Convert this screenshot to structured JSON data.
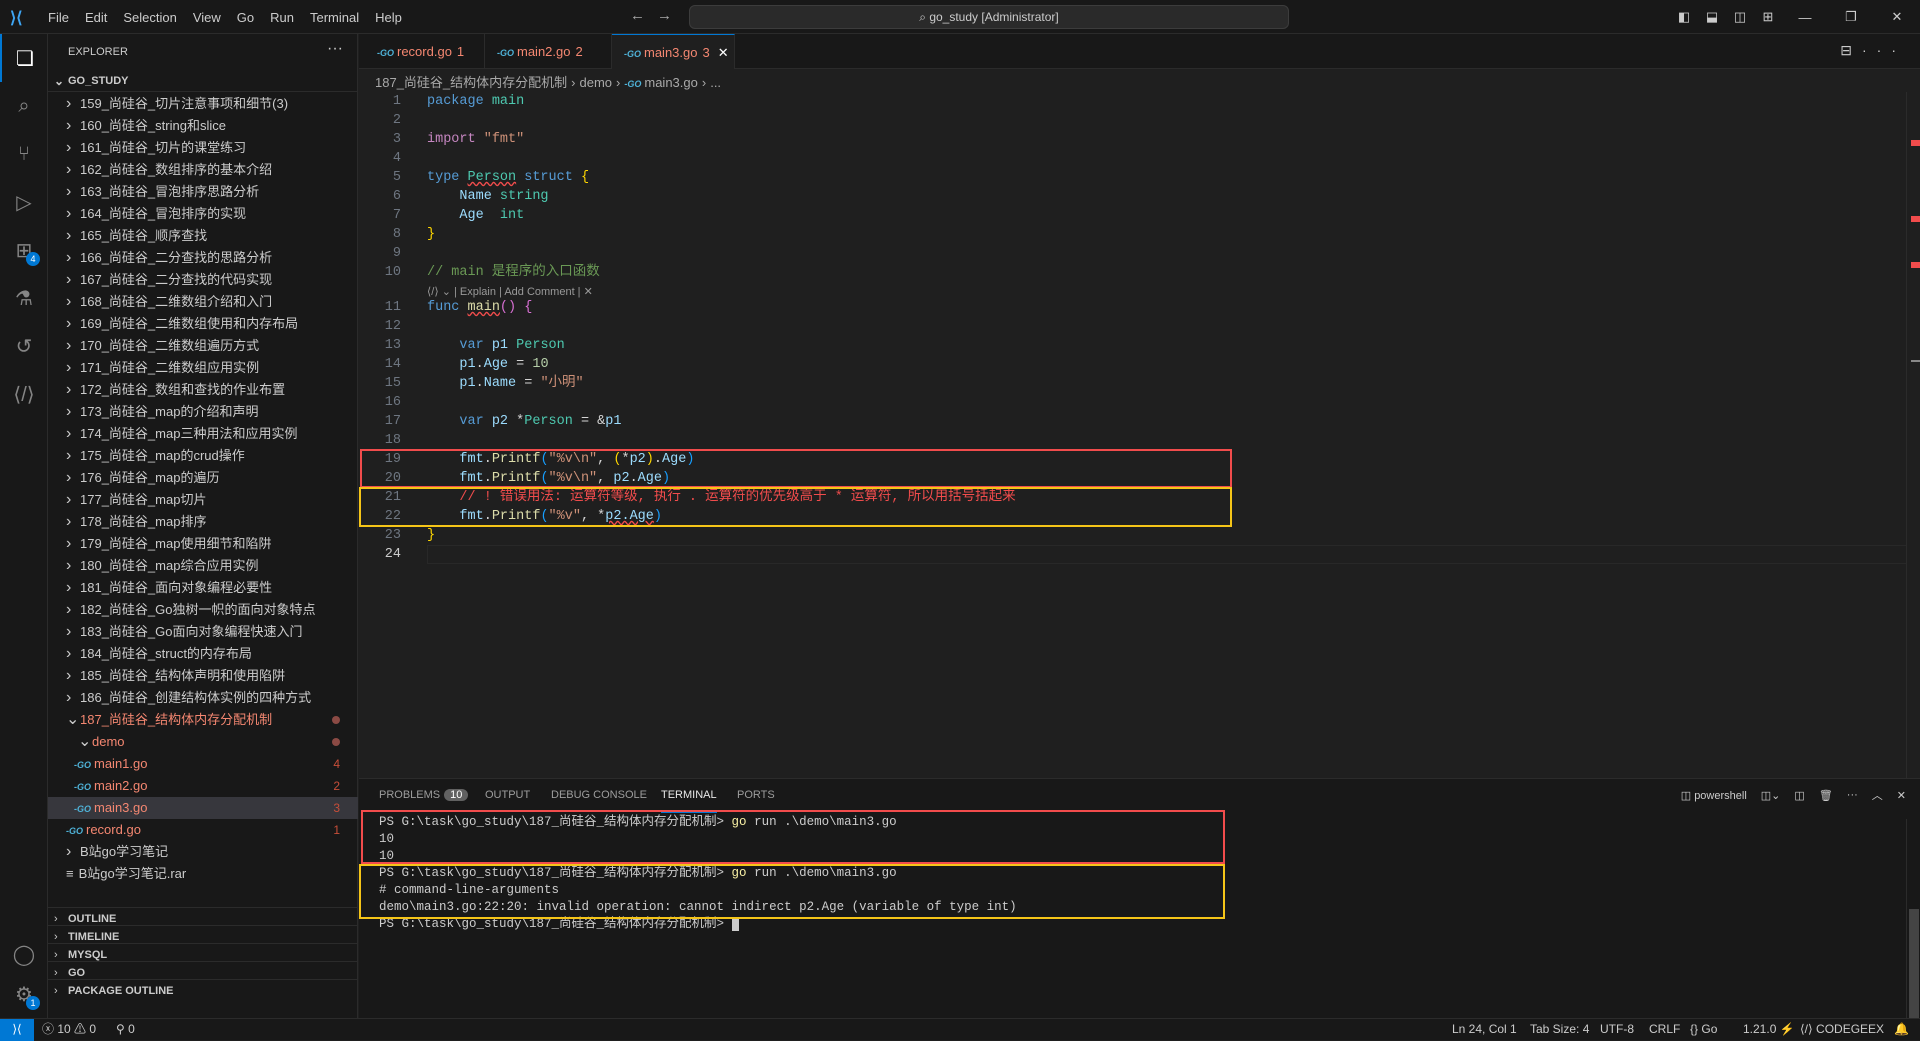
{
  "titlebar": {
    "menus": [
      "File",
      "Edit",
      "Selection",
      "View",
      "Go",
      "Run",
      "Terminal",
      "Help"
    ],
    "search": "go_study [Administrator]"
  },
  "activity": {
    "extensions_badge": "4",
    "settings_badge": "1"
  },
  "explorer": {
    "title": "EXPLORER",
    "root": "GO_STUDY",
    "folders": [
      "159_尚硅谷_切片注意事项和细节(3)",
      "160_尚硅谷_string和slice",
      "161_尚硅谷_切片的课堂练习",
      "162_尚硅谷_数组排序的基本介绍",
      "163_尚硅谷_冒泡排序思路分析",
      "164_尚硅谷_冒泡排序的实现",
      "165_尚硅谷_顺序查找",
      "166_尚硅谷_二分查找的思路分析",
      "167_尚硅谷_二分查找的代码实现",
      "168_尚硅谷_二维数组介绍和入门",
      "169_尚硅谷_二维数组使用和内存布局",
      "170_尚硅谷_二维数组遍历方式",
      "171_尚硅谷_二维数组应用实例",
      "172_尚硅谷_数组和查找的作业布置",
      "173_尚硅谷_map的介绍和声明",
      "174_尚硅谷_map三种用法和应用实例",
      "175_尚硅谷_map的crud操作",
      "176_尚硅谷_map的遍历",
      "177_尚硅谷_map切片",
      "178_尚硅谷_map排序",
      "179_尚硅谷_map使用细节和陷阱",
      "180_尚硅谷_map综合应用实例",
      "181_尚硅谷_面向对象编程必要性",
      "182_尚硅谷_Go独树一帜的面向对象特点",
      "183_尚硅谷_Go面向对象编程快速入门",
      "184_尚硅谷_struct的内存布局",
      "185_尚硅谷_结构体声明和使用陷阱",
      "186_尚硅谷_创建结构体实例的四种方式"
    ],
    "open_folder": "187_尚硅谷_结构体内存分配机制",
    "subfolder": "demo",
    "files": [
      {
        "name": "main1.go",
        "problems": "4"
      },
      {
        "name": "main2.go",
        "problems": "2"
      },
      {
        "name": "main3.go",
        "problems": "3"
      }
    ],
    "record": {
      "name": "record.go",
      "problems": "1"
    },
    "notes_folder": "B站go学习笔记",
    "rar": "B站go学习笔记.rar",
    "sections": [
      "OUTLINE",
      "TIMELINE",
      "MYSQL",
      "GO",
      "PACKAGE OUTLINE"
    ]
  },
  "tabs": [
    {
      "name": "record.go",
      "problems": "1"
    },
    {
      "name": "main2.go",
      "problems": "2"
    },
    {
      "name": "main3.go",
      "problems": "3"
    }
  ],
  "breadcrumb": [
    "187_尚硅谷_结构体内存分配机制",
    "demo",
    "main3.go",
    "..."
  ],
  "code": [
    [
      [
        "k",
        "package"
      ],
      [
        "w",
        " "
      ],
      [
        "t",
        "main"
      ]
    ],
    [],
    [
      [
        "p",
        "import"
      ],
      [
        "w",
        " "
      ],
      [
        "s",
        "\"fmt\""
      ]
    ],
    [],
    [
      [
        "k",
        "type"
      ],
      [
        "w",
        " "
      ],
      [
        "t",
        "Person",
        "squig"
      ],
      [
        "w",
        " "
      ],
      [
        "k",
        "struct"
      ],
      [
        "w",
        " "
      ],
      [
        "b1",
        "{"
      ]
    ],
    [
      [
        "w",
        "    "
      ],
      [
        "v",
        "Name"
      ],
      [
        "w",
        " "
      ],
      [
        "t",
        "string"
      ]
    ],
    [
      [
        "w",
        "    "
      ],
      [
        "v",
        "Age"
      ],
      [
        "w",
        "  "
      ],
      [
        "t",
        "int"
      ]
    ],
    [
      [
        "b1",
        "}"
      ]
    ],
    [],
    [
      [
        "c",
        "// main 是程序的入口函数"
      ]
    ],
    [
      [
        "k",
        "func"
      ],
      [
        "w",
        " "
      ],
      [
        "f",
        "main",
        "squig"
      ],
      [
        "b2",
        "()"
      ],
      [
        "w",
        " "
      ],
      [
        "b2",
        "{"
      ]
    ],
    [],
    [
      [
        "w",
        "    "
      ],
      [
        "k",
        "var"
      ],
      [
        "w",
        " "
      ],
      [
        "v",
        "p1"
      ],
      [
        "w",
        " "
      ],
      [
        "t",
        "Person"
      ]
    ],
    [
      [
        "w",
        "    "
      ],
      [
        "v",
        "p1"
      ],
      [
        "w",
        "."
      ],
      [
        "v",
        "Age"
      ],
      [
        "w",
        " = "
      ],
      [
        "n",
        "10"
      ]
    ],
    [
      [
        "w",
        "    "
      ],
      [
        "v",
        "p1"
      ],
      [
        "w",
        "."
      ],
      [
        "v",
        "Name"
      ],
      [
        "w",
        " = "
      ],
      [
        "s",
        "\"小明\""
      ]
    ],
    [],
    [
      [
        "w",
        "    "
      ],
      [
        "k",
        "var"
      ],
      [
        "w",
        " "
      ],
      [
        "v",
        "p2"
      ],
      [
        "w",
        " *"
      ],
      [
        "t",
        "Person"
      ],
      [
        "w",
        " = &"
      ],
      [
        "v",
        "p1"
      ]
    ],
    [],
    [
      [
        "w",
        "    "
      ],
      [
        "v",
        "fmt"
      ],
      [
        "w",
        "."
      ],
      [
        "f",
        "Printf"
      ],
      [
        "b3",
        "("
      ],
      [
        "s",
        "\"%v\\n\""
      ],
      [
        "w",
        ", "
      ],
      [
        "b1",
        "("
      ],
      [
        "w",
        "*"
      ],
      [
        "v",
        "p2"
      ],
      [
        "b1",
        ")"
      ],
      [
        "w",
        "."
      ],
      [
        "v",
        "Age"
      ],
      [
        "b3",
        ")"
      ]
    ],
    [
      [
        "w",
        "    "
      ],
      [
        "v",
        "fmt"
      ],
      [
        "w",
        "."
      ],
      [
        "f",
        "Printf"
      ],
      [
        "b3",
        "("
      ],
      [
        "s",
        "\"%v\\n\""
      ],
      [
        "w",
        ", "
      ],
      [
        "v",
        "p2"
      ],
      [
        "w",
        "."
      ],
      [
        "v",
        "Age"
      ],
      [
        "b3",
        ")"
      ]
    ],
    [
      [
        "w",
        "    "
      ],
      [
        "r",
        "// ! 错误用法: 运算符等级, 执行 . 运算符的优先级高于 * 运算符, 所以用括号括起来"
      ]
    ],
    [
      [
        "w",
        "    "
      ],
      [
        "v",
        "fmt"
      ],
      [
        "w",
        "."
      ],
      [
        "f",
        "Printf"
      ],
      [
        "b3",
        "("
      ],
      [
        "s",
        "\"%v\""
      ],
      [
        "w",
        ", *"
      ],
      [
        "v",
        "p2.Age",
        "squig"
      ],
      [
        "b3",
        ")"
      ]
    ],
    [
      [
        "b1",
        "}"
      ]
    ],
    []
  ],
  "codelens": "⟨/⟩ ⌄ | Explain | Add Comment |  ✕",
  "panel": {
    "tabs": [
      "PROBLEMS",
      "OUTPUT",
      "DEBUG CONSOLE",
      "TERMINAL",
      "PORTS"
    ],
    "problems_count": "10",
    "active": "TERMINAL",
    "shell": "powershell"
  },
  "terminal": [
    {
      "prompt": "PS G:\\task\\go_study\\187_尚硅谷_结构体内存分配机制> ",
      "cmd": "go",
      " rest": "",
      " text": ""
    },
    {
      "text": "10"
    },
    {
      "text": "10"
    },
    {
      "prompt": "PS G:\\task\\go_study\\187_尚硅谷_结构体内存分配机制> ",
      "cmd": "go",
      "rest": " run .\\demo\\main3.go"
    },
    {
      "text": "# command-line-arguments"
    },
    {
      "text": "demo\\main3.go:22:20: invalid operation: cannot indirect p2.Age (variable of type int)"
    },
    {
      "prompt": "PS G:\\task\\go_study\\187_尚硅谷_结构体内存分配机制> "
    }
  ],
  "status": {
    "errors": "10",
    "warnings": "0",
    "ports": "0",
    "position": "Ln 24, Col 1",
    "tab_size": "Tab Size: 4",
    "encoding": "UTF-8",
    "eol": "CRLF",
    "language": "Go",
    "go_version": "1.21.0",
    "codegeex": "CODEGEEX"
  },
  "colors": {
    "accent": "#0078d4",
    "error_box": "#f14c4c",
    "warning_box": "#f5c518"
  }
}
